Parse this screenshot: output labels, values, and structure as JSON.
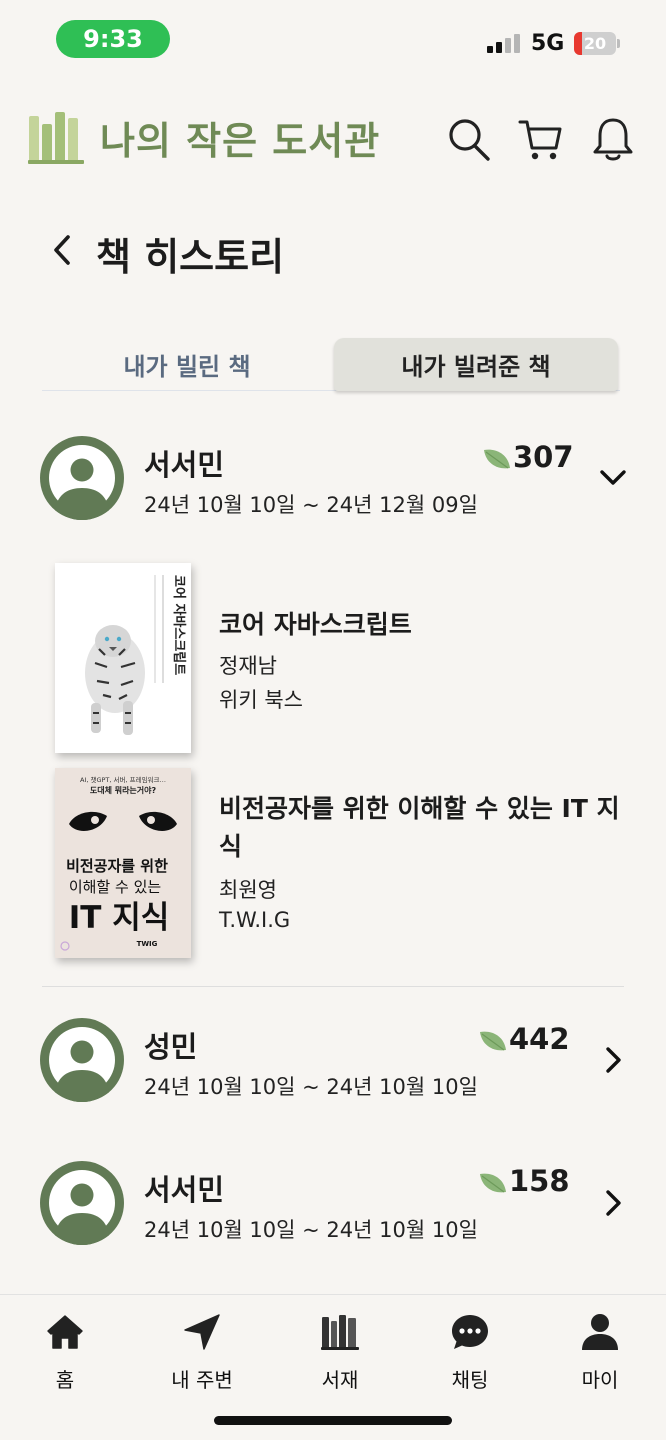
{
  "status_bar": {
    "time": "9:33",
    "network": "5G",
    "battery": "20",
    "battery_level": 0.2,
    "time_pill_color": "#2fbf55"
  },
  "header": {
    "app_title": "나의 작은 도서관",
    "brand_color": "#6f8a55",
    "icons": [
      "library-logo",
      "search-icon",
      "cart-icon",
      "bell-icon"
    ]
  },
  "page": {
    "title": "책 히스토리",
    "back_icon": "back-chevron-icon"
  },
  "tabs": [
    {
      "label": "내가 빌린 책",
      "active": false
    },
    {
      "label": "내가 빌려준 책",
      "active": true
    }
  ],
  "lendings": [
    {
      "name": "서서민",
      "points": "307",
      "period": "24년 10월 10일 ~ 24년 12월 09일",
      "expanded": true,
      "books": [
        {
          "title": "코어 자바스크립트",
          "author": "정재남",
          "publisher": "위키 북스"
        },
        {
          "title": "비전공자를 위한 이해할 수 있는 IT 지식",
          "author": "최원영",
          "publisher": "T.W.I.G"
        }
      ]
    },
    {
      "name": "성민",
      "points": "442",
      "period": "24년 10월 10일 ~ 24년 10월 10일",
      "expanded": false
    },
    {
      "name": "서서민",
      "points": "158",
      "period": "24년 10월 10일 ~ 24년 10월 10일",
      "expanded": false
    }
  ],
  "covers": {
    "core_js": {
      "spine_title": "코어 자바스크립트"
    },
    "it_book": {
      "tagline_1": "AI, 챗GPT, 서버, 프레임워크…",
      "tagline_2": "도대체 뭐라는거야?",
      "title_line_1": "비전공자를 위한",
      "title_line_2": "이해할 수 있는",
      "title_line_3": "IT 지식",
      "publisher_mark": "TWIG"
    }
  },
  "bottom_nav": [
    {
      "label": "홈",
      "icon": "home-icon"
    },
    {
      "label": "내 주변",
      "icon": "location-arrow-icon"
    },
    {
      "label": "서재",
      "icon": "bookshelf-icon"
    },
    {
      "label": "채팅",
      "icon": "chat-bubble-icon"
    },
    {
      "label": "마이",
      "icon": "person-icon"
    }
  ],
  "colors": {
    "avatar": "#617a55",
    "leaf": "#8bb578",
    "background": "#f7f5f2"
  }
}
